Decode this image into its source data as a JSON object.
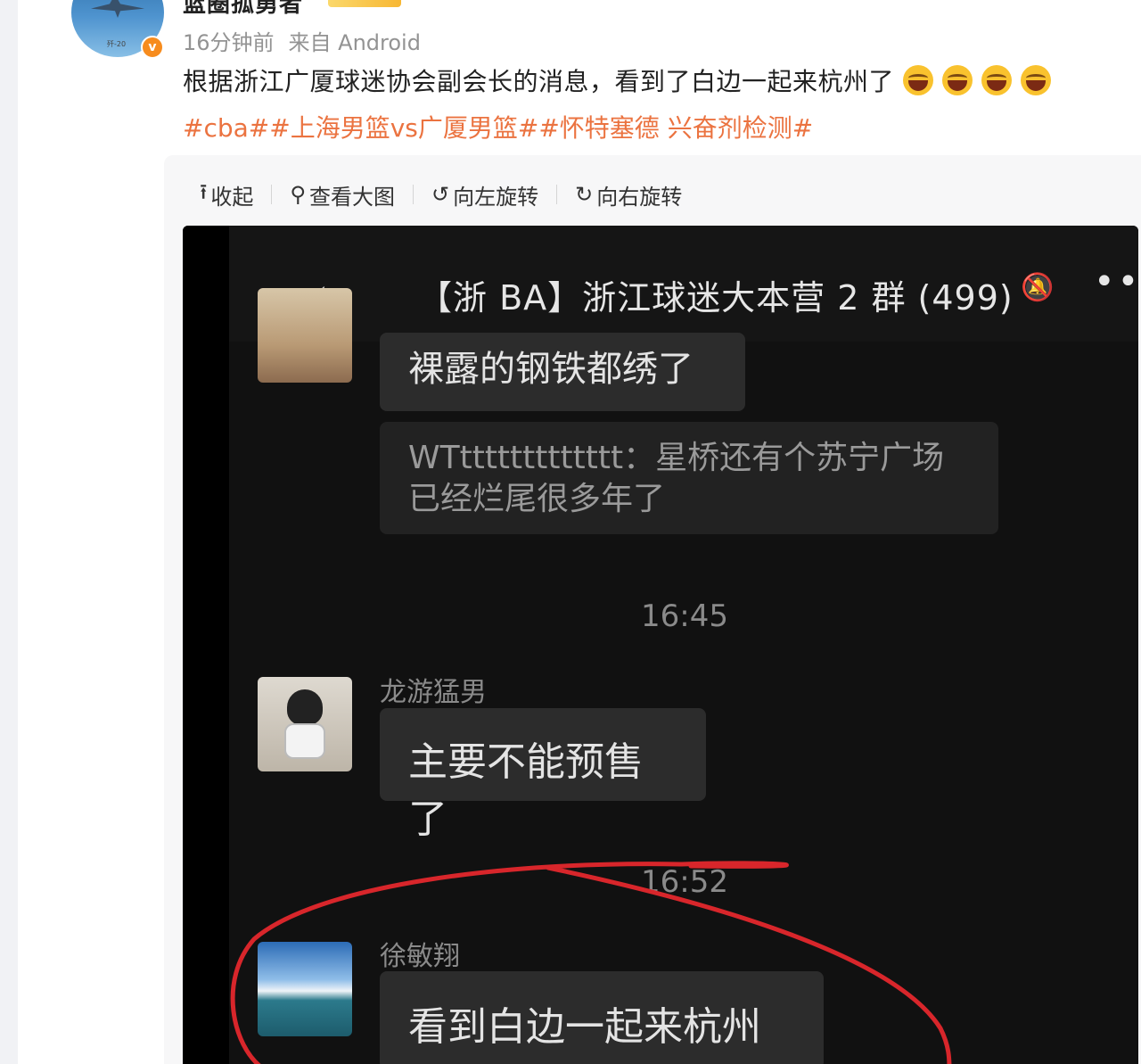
{
  "post": {
    "username": "篮圈孤勇者",
    "time": "16分钟前",
    "source": "来自 Android",
    "text": "根据浙江广厦球迷协会副会长的消息，看到了白边一起来杭州了",
    "emoji_count": 4,
    "hashtags": "#cba##上海男篮vs广厦男篮##怀特塞德 兴奋剂检测#",
    "avatar_tag": "歼-20"
  },
  "toolbar": {
    "collapse": "收起",
    "view_large": "查看大图",
    "rotate_left": "向左旋转",
    "rotate_right": "向右旋转"
  },
  "chat": {
    "title": "【浙 BA】浙江球迷大本营 2 群 (499)",
    "messages": {
      "msg1": "裸露的钢铁都绣了",
      "quote": "WTttttttttttttt：星桥还有个苏宁广场已经烂尾很多年了",
      "time1": "16:45",
      "sender2": "龙游猛男",
      "msg2": "主要不能预售了",
      "time2": "16:52",
      "sender3": "徐敏翔",
      "msg3": "看到白边一起来杭州了"
    }
  },
  "colors": {
    "hashtag": "#eb7340",
    "verified": "#f78c1e",
    "annotation": "#d8262b"
  },
  "icons": [
    "upload-icon",
    "search-icon",
    "rotate-left-icon",
    "rotate-right-icon",
    "back-icon",
    "mute-icon",
    "more-icon"
  ]
}
